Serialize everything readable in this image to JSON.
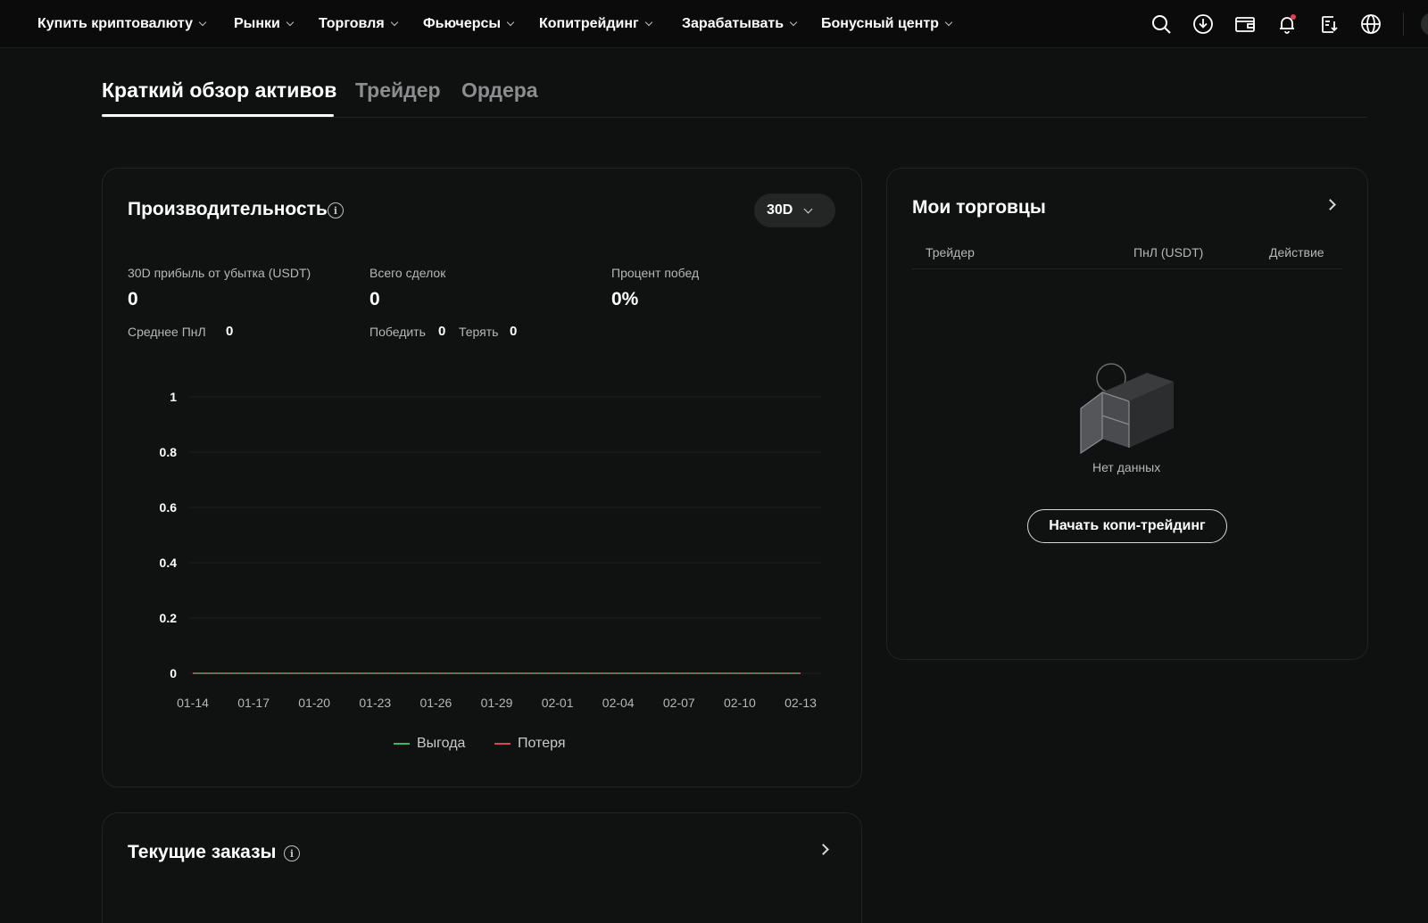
{
  "nav": {
    "items": [
      {
        "label": "Купить криптовалюту"
      },
      {
        "label": "Рынки"
      },
      {
        "label": "Торговля"
      },
      {
        "label": "Фьючерсы"
      },
      {
        "label": "Копитрейдинг"
      },
      {
        "label": "Зарабатывать"
      },
      {
        "label": "Бонусный центр"
      }
    ],
    "icons": [
      "search-icon",
      "download-icon",
      "wallet-icon",
      "bell-icon",
      "orders-icon",
      "globe-icon"
    ],
    "notification_dot_color": "#e0405a"
  },
  "tabs": [
    {
      "label": "Краткий обзор активов",
      "active": true
    },
    {
      "label": "Трейдер",
      "active": false
    },
    {
      "label": "Ордера",
      "active": false
    }
  ],
  "performance": {
    "title": "Производительность",
    "period": "30D",
    "pnl_label": "30D прибыль от убытка (USDT)",
    "pnl_value": "0",
    "avg_pnl_label": "Среднее ПнЛ",
    "avg_pnl_value": "0",
    "total_trades_label": "Всего сделок",
    "total_trades_value": "0",
    "wins_label": "Победить",
    "wins_value": "0",
    "losses_label": "Терять",
    "losses_value": "0",
    "win_rate_label": "Процент побед",
    "win_rate_value": "0%"
  },
  "chart_data": {
    "type": "line",
    "x": [
      "01-14",
      "01-17",
      "01-20",
      "01-23",
      "01-26",
      "01-29",
      "02-01",
      "02-04",
      "02-07",
      "02-10",
      "02-13"
    ],
    "series": [
      {
        "name": "Выгода",
        "color": "#2ebd6b",
        "values": [
          0,
          0,
          0,
          0,
          0,
          0,
          0,
          0,
          0,
          0,
          0
        ]
      },
      {
        "name": "Потеря",
        "color": "#e0405a",
        "values": [
          0,
          0,
          0,
          0,
          0,
          0,
          0,
          0,
          0,
          0,
          0
        ]
      }
    ],
    "y_ticks": [
      "1",
      "0.8",
      "0.6",
      "0.4",
      "0.2",
      "0"
    ],
    "ylim": [
      0,
      1
    ],
    "grid": true,
    "legend_position": "bottom-center"
  },
  "current_orders": {
    "title": "Текущие заказы"
  },
  "my_traders": {
    "title": "Мои торговцы",
    "columns": [
      "Трейдер",
      "ПнЛ (USDT)",
      "Действие"
    ],
    "empty_text": "Нет данных",
    "cta_label": "Начать копи-трейдинг"
  }
}
